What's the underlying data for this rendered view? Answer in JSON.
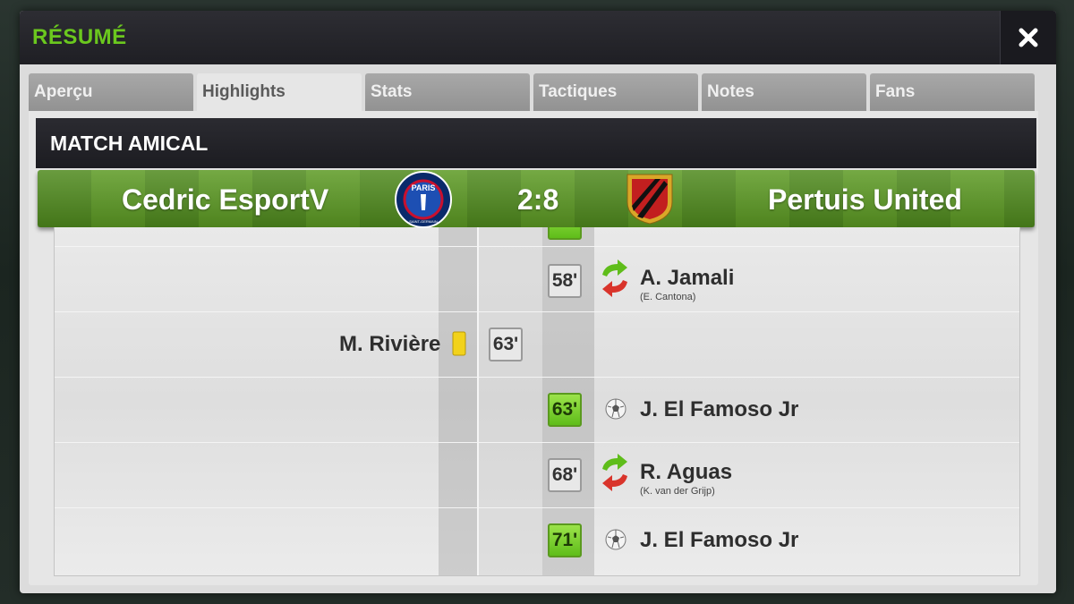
{
  "modal": {
    "title": "RÉSUMÉ",
    "close_icon": "close-icon"
  },
  "tabs": [
    {
      "label": "Aperçu",
      "active": false
    },
    {
      "label": "Highlights",
      "active": true
    },
    {
      "label": "Stats",
      "active": false
    },
    {
      "label": "Tactiques",
      "active": false
    },
    {
      "label": "Notes",
      "active": false
    },
    {
      "label": "Fans",
      "active": false
    }
  ],
  "match": {
    "type": "MATCH AMICAL",
    "home_team": "Cedric EsportV",
    "away_team": "Pertuis United",
    "score": "2:8",
    "home_crest_text": "PARIS",
    "home_crest_subtext": "SAINT-GERMAIN"
  },
  "events": [
    {
      "minute": "58'",
      "side": "away",
      "kind": "substitution",
      "player": "A. Jamali",
      "sub": "(E. Cantona)"
    },
    {
      "minute": "63'",
      "side": "home",
      "kind": "yellow-card",
      "player": "M. Rivière",
      "sub": ""
    },
    {
      "minute": "63'",
      "side": "away",
      "kind": "goal",
      "player": "J. El Famoso Jr",
      "sub": ""
    },
    {
      "minute": "68'",
      "side": "away",
      "kind": "substitution",
      "player": "R. Aguas",
      "sub": "(K. van der Grijp)"
    },
    {
      "minute": "71'",
      "side": "away",
      "kind": "goal",
      "player": "J. El Famoso Jr",
      "sub": ""
    }
  ],
  "colors": {
    "accent_green": "#6bc81e",
    "goal_green": "#5fbd1a",
    "card_yellow": "#f2d21b"
  }
}
